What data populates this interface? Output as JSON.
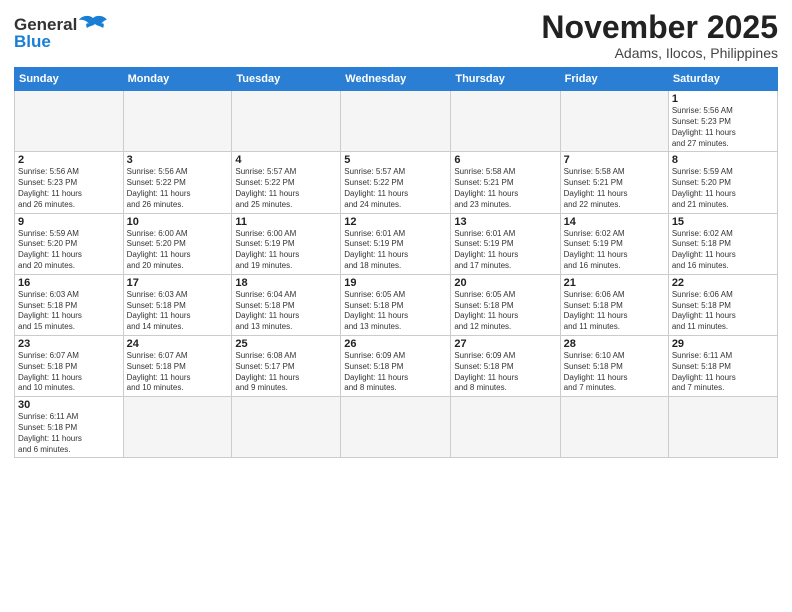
{
  "logo": {
    "general": "General",
    "blue": "Blue"
  },
  "title": "November 2025",
  "subtitle": "Adams, Ilocos, Philippines",
  "days_header": [
    "Sunday",
    "Monday",
    "Tuesday",
    "Wednesday",
    "Thursday",
    "Friday",
    "Saturday"
  ],
  "weeks": [
    [
      {
        "day": "",
        "info": ""
      },
      {
        "day": "",
        "info": ""
      },
      {
        "day": "",
        "info": ""
      },
      {
        "day": "",
        "info": ""
      },
      {
        "day": "",
        "info": ""
      },
      {
        "day": "",
        "info": ""
      },
      {
        "day": "1",
        "info": "Sunrise: 5:56 AM\nSunset: 5:23 PM\nDaylight: 11 hours\nand 27 minutes."
      }
    ],
    [
      {
        "day": "2",
        "info": "Sunrise: 5:56 AM\nSunset: 5:23 PM\nDaylight: 11 hours\nand 26 minutes."
      },
      {
        "day": "3",
        "info": "Sunrise: 5:56 AM\nSunset: 5:22 PM\nDaylight: 11 hours\nand 26 minutes."
      },
      {
        "day": "4",
        "info": "Sunrise: 5:57 AM\nSunset: 5:22 PM\nDaylight: 11 hours\nand 25 minutes."
      },
      {
        "day": "5",
        "info": "Sunrise: 5:57 AM\nSunset: 5:22 PM\nDaylight: 11 hours\nand 24 minutes."
      },
      {
        "day": "6",
        "info": "Sunrise: 5:58 AM\nSunset: 5:21 PM\nDaylight: 11 hours\nand 23 minutes."
      },
      {
        "day": "7",
        "info": "Sunrise: 5:58 AM\nSunset: 5:21 PM\nDaylight: 11 hours\nand 22 minutes."
      },
      {
        "day": "8",
        "info": "Sunrise: 5:59 AM\nSunset: 5:20 PM\nDaylight: 11 hours\nand 21 minutes."
      }
    ],
    [
      {
        "day": "9",
        "info": "Sunrise: 5:59 AM\nSunset: 5:20 PM\nDaylight: 11 hours\nand 20 minutes."
      },
      {
        "day": "10",
        "info": "Sunrise: 6:00 AM\nSunset: 5:20 PM\nDaylight: 11 hours\nand 20 minutes."
      },
      {
        "day": "11",
        "info": "Sunrise: 6:00 AM\nSunset: 5:19 PM\nDaylight: 11 hours\nand 19 minutes."
      },
      {
        "day": "12",
        "info": "Sunrise: 6:01 AM\nSunset: 5:19 PM\nDaylight: 11 hours\nand 18 minutes."
      },
      {
        "day": "13",
        "info": "Sunrise: 6:01 AM\nSunset: 5:19 PM\nDaylight: 11 hours\nand 17 minutes."
      },
      {
        "day": "14",
        "info": "Sunrise: 6:02 AM\nSunset: 5:19 PM\nDaylight: 11 hours\nand 16 minutes."
      },
      {
        "day": "15",
        "info": "Sunrise: 6:02 AM\nSunset: 5:18 PM\nDaylight: 11 hours\nand 16 minutes."
      }
    ],
    [
      {
        "day": "16",
        "info": "Sunrise: 6:03 AM\nSunset: 5:18 PM\nDaylight: 11 hours\nand 15 minutes."
      },
      {
        "day": "17",
        "info": "Sunrise: 6:03 AM\nSunset: 5:18 PM\nDaylight: 11 hours\nand 14 minutes."
      },
      {
        "day": "18",
        "info": "Sunrise: 6:04 AM\nSunset: 5:18 PM\nDaylight: 11 hours\nand 13 minutes."
      },
      {
        "day": "19",
        "info": "Sunrise: 6:05 AM\nSunset: 5:18 PM\nDaylight: 11 hours\nand 13 minutes."
      },
      {
        "day": "20",
        "info": "Sunrise: 6:05 AM\nSunset: 5:18 PM\nDaylight: 11 hours\nand 12 minutes."
      },
      {
        "day": "21",
        "info": "Sunrise: 6:06 AM\nSunset: 5:18 PM\nDaylight: 11 hours\nand 11 minutes."
      },
      {
        "day": "22",
        "info": "Sunrise: 6:06 AM\nSunset: 5:18 PM\nDaylight: 11 hours\nand 11 minutes."
      }
    ],
    [
      {
        "day": "23",
        "info": "Sunrise: 6:07 AM\nSunset: 5:18 PM\nDaylight: 11 hours\nand 10 minutes."
      },
      {
        "day": "24",
        "info": "Sunrise: 6:07 AM\nSunset: 5:18 PM\nDaylight: 11 hours\nand 10 minutes."
      },
      {
        "day": "25",
        "info": "Sunrise: 6:08 AM\nSunset: 5:17 PM\nDaylight: 11 hours\nand 9 minutes."
      },
      {
        "day": "26",
        "info": "Sunrise: 6:09 AM\nSunset: 5:18 PM\nDaylight: 11 hours\nand 8 minutes."
      },
      {
        "day": "27",
        "info": "Sunrise: 6:09 AM\nSunset: 5:18 PM\nDaylight: 11 hours\nand 8 minutes."
      },
      {
        "day": "28",
        "info": "Sunrise: 6:10 AM\nSunset: 5:18 PM\nDaylight: 11 hours\nand 7 minutes."
      },
      {
        "day": "29",
        "info": "Sunrise: 6:11 AM\nSunset: 5:18 PM\nDaylight: 11 hours\nand 7 minutes."
      }
    ],
    [
      {
        "day": "30",
        "info": "Sunrise: 6:11 AM\nSunset: 5:18 PM\nDaylight: 11 hours\nand 6 minutes."
      },
      {
        "day": "",
        "info": ""
      },
      {
        "day": "",
        "info": ""
      },
      {
        "day": "",
        "info": ""
      },
      {
        "day": "",
        "info": ""
      },
      {
        "day": "",
        "info": ""
      },
      {
        "day": "",
        "info": ""
      }
    ]
  ]
}
